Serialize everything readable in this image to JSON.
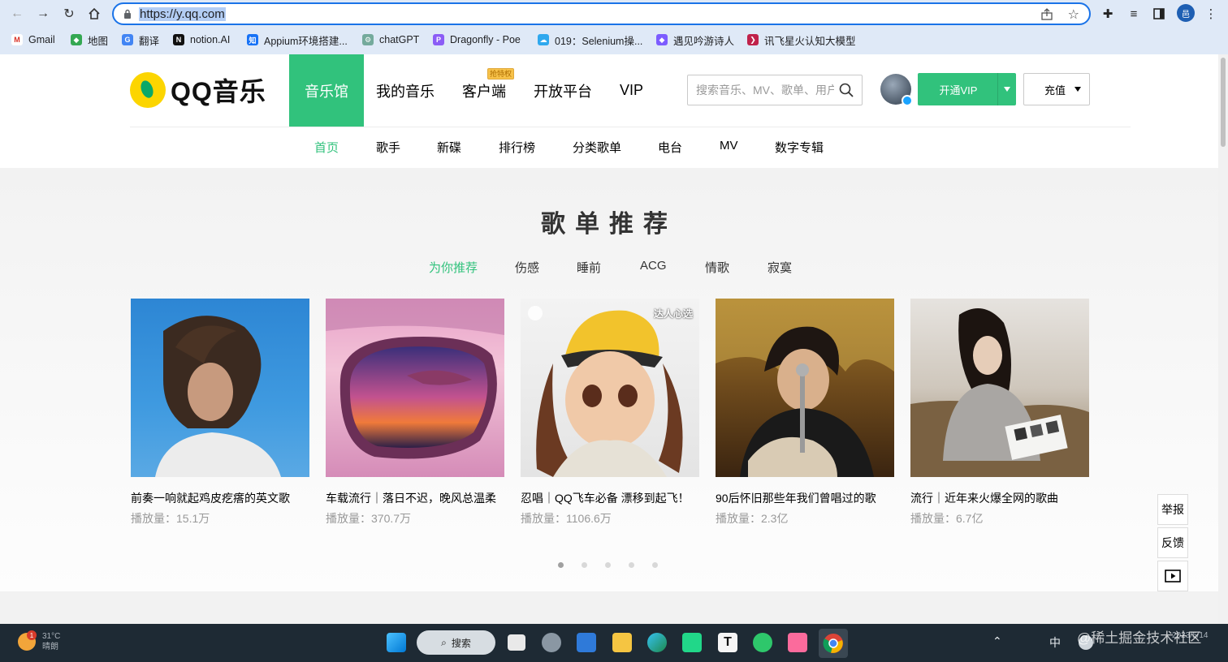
{
  "browser": {
    "url": "https://y.qq.com",
    "bookmarks": [
      {
        "label": "Gmail",
        "color": "#d93025",
        "glyph": "M"
      },
      {
        "label": "地图",
        "color": "#34a853",
        "glyph": "◆"
      },
      {
        "label": "翻译",
        "color": "#4285f4",
        "glyph": "G"
      },
      {
        "label": "notion.AI",
        "color": "#111111",
        "glyph": "N"
      },
      {
        "label": "Appium环境搭建...",
        "color": "#1772f6",
        "glyph": "知"
      },
      {
        "label": "chatGPT",
        "color": "#74aa9c",
        "glyph": "⚙"
      },
      {
        "label": "Dragonfly - Poe",
        "color": "#8b5cf6",
        "glyph": "P"
      },
      {
        "label": "019：Selenium操...",
        "color": "#2fa8ee",
        "glyph": "☁"
      },
      {
        "label": "遇见吟游诗人",
        "color": "#7c5cff",
        "glyph": "◆"
      },
      {
        "label": "讯飞星火认知大模型",
        "color": "#c0224b",
        "glyph": "❯"
      }
    ]
  },
  "site": {
    "logo_text": "QQ音乐",
    "nav": [
      {
        "label": "音乐馆",
        "active": true
      },
      {
        "label": "我的音乐",
        "active": false
      },
      {
        "label": "客户端",
        "active": false,
        "badge": "抢特权"
      },
      {
        "label": "开放平台",
        "active": false
      },
      {
        "label": "VIP",
        "active": false
      }
    ],
    "search_placeholder": "搜索音乐、MV、歌单、用户",
    "vip_button": "开通VIP",
    "charge_button": "充值",
    "subnav": [
      "首页",
      "歌手",
      "新碟",
      "排行榜",
      "分类歌单",
      "电台",
      "MV",
      "数字专辑"
    ],
    "subnav_active": "首页"
  },
  "recommend": {
    "title": "歌单推荐",
    "categories": [
      "为你推荐",
      "伤感",
      "睡前",
      "ACG",
      "情歌",
      "寂寞"
    ],
    "active_category": "为你推荐",
    "playlists": [
      {
        "title": "前奏一响就起鸡皮疙瘩的英文歌",
        "plays": "播放量：15.1万"
      },
      {
        "title": "车载流行｜落日不迟，晚风总温柔",
        "plays": "播放量：370.7万"
      },
      {
        "title": "忍唱｜QQ飞车必备 漂移到起飞！",
        "plays": "播放量：1106.6万",
        "overlay": "达人心选"
      },
      {
        "title": "90后怀旧那些年我们曾唱过的歌",
        "plays": "播放量：2.3亿"
      },
      {
        "title": "流行｜近年来火爆全网的歌曲",
        "plays": "播放量：6.7亿"
      }
    ],
    "page_count": 5,
    "current_page": 1
  },
  "side_tools": [
    "举报",
    "反馈"
  ],
  "taskbar": {
    "weather_badge": "1",
    "weather_temp": "31°C",
    "weather_desc": "晴朗",
    "search_label": "搜索",
    "ime": "中",
    "date": "2023/5/14"
  },
  "watermark": "@稀土掘金技术社区",
  "colors": {
    "accent": "#31c27c",
    "chrome": "#dfe9f7",
    "taskbar": "#1e2a34"
  }
}
